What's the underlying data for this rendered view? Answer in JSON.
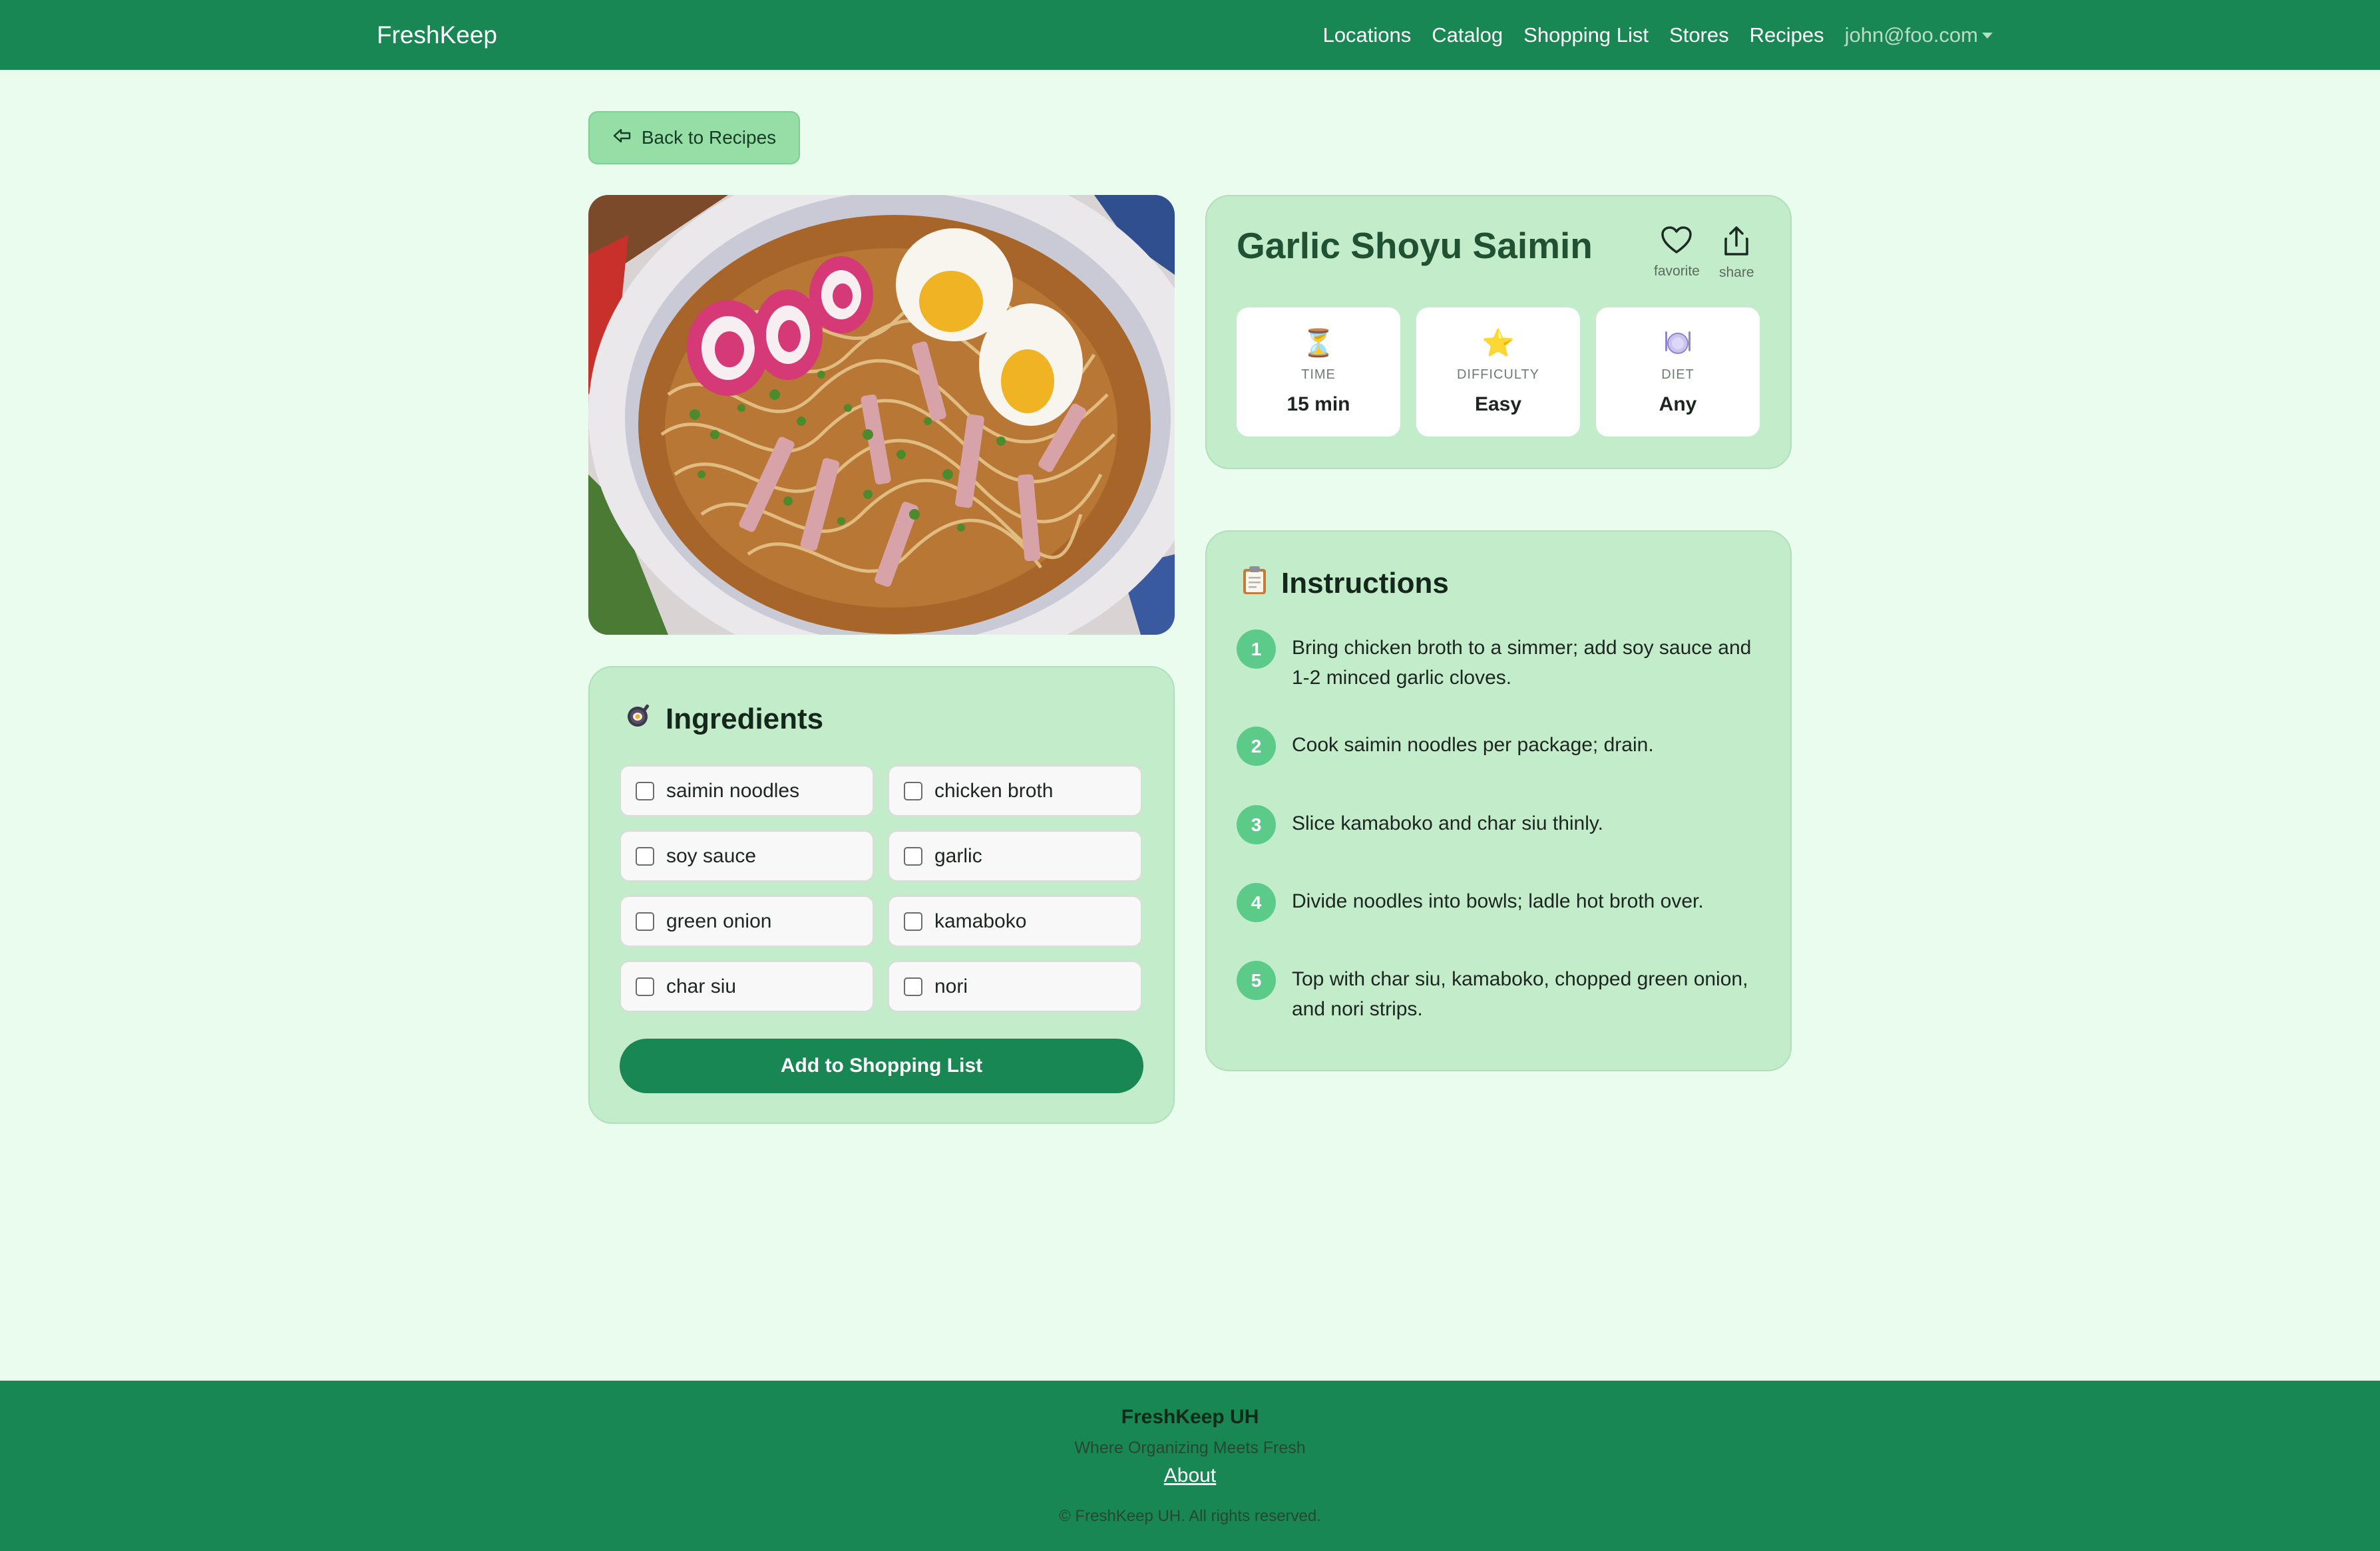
{
  "navbar": {
    "brand": "FreshKeep",
    "links": [
      "Locations",
      "Catalog",
      "Shopping List",
      "Stores",
      "Recipes"
    ],
    "user": "john@foo.com"
  },
  "back_button": {
    "label": "Back to Recipes"
  },
  "recipe": {
    "title": "Garlic Shoyu Saimin",
    "favorite_label": "favorite",
    "share_label": "share",
    "stats": [
      {
        "icon": "hourglass-icon",
        "key": "TIME",
        "value": "15 min"
      },
      {
        "icon": "star-icon",
        "key": "DIFFICULTY",
        "value": "Easy"
      },
      {
        "icon": "plate-icon",
        "key": "DIET",
        "value": "Any"
      }
    ]
  },
  "ingredients": {
    "heading": "Ingredients",
    "items": [
      "saimin noodles",
      "chicken broth",
      "soy sauce",
      "garlic",
      "green onion",
      "kamaboko",
      "char siu",
      "nori"
    ],
    "add_button": "Add to Shopping List"
  },
  "instructions": {
    "heading": "Instructions",
    "steps": [
      {
        "num": "1",
        "text": "Bring chicken broth to a simmer; add soy sauce and 1-2 minced garlic cloves."
      },
      {
        "num": "2",
        "text": "Cook saimin noodles per package; drain."
      },
      {
        "num": "3",
        "text": "Slice kamaboko and char siu thinly."
      },
      {
        "num": "4",
        "text": "Divide noodles into bowls; ladle hot broth over."
      },
      {
        "num": "5",
        "text": "Top with char siu, kamaboko, chopped green onion, and nori strips."
      }
    ]
  },
  "footer": {
    "title": "FreshKeep UH",
    "tagline": "Where Organizing Meets Fresh",
    "about": "About",
    "copyright": "© FreshKeep UH. All rights reserved."
  },
  "colors": {
    "primary": "#198754",
    "background": "#e9fcee",
    "card": "#c3ecca",
    "step_badge": "#5ccb8a"
  }
}
